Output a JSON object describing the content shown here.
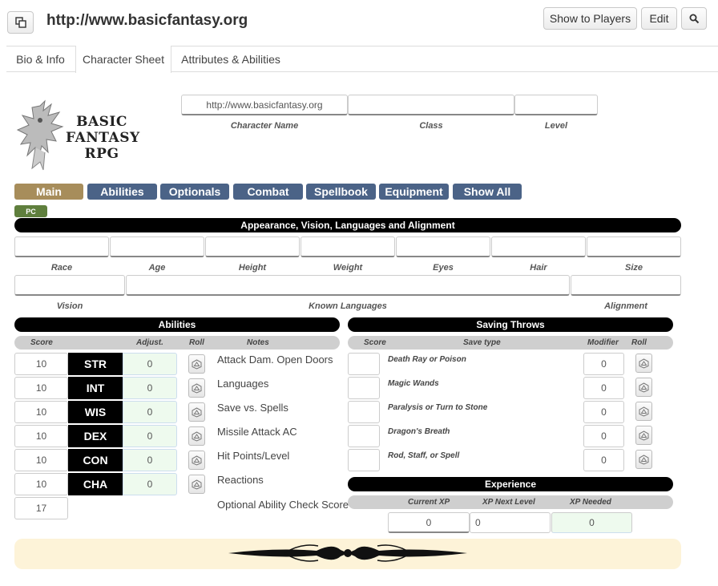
{
  "header": {
    "title": "http://www.basicfantasy.org",
    "show_to_players": "Show to Players",
    "edit": "Edit"
  },
  "tabs": [
    {
      "label": "Bio & Info"
    },
    {
      "label": "Character Sheet"
    },
    {
      "label": "Attributes & Abilities"
    }
  ],
  "logo": {
    "line1": "BASIC",
    "line2": "FANTASY",
    "line3": "RPG"
  },
  "top_fields": {
    "character_name_value": "http://www.basicfantasy.org",
    "character_name_label": "Character Name",
    "class_label": "Class",
    "level_label": "Level"
  },
  "nav": [
    "Main",
    "Abilities",
    "Optionals",
    "Combat",
    "Spellbook",
    "Equipment",
    "Show All"
  ],
  "badge": "PC",
  "appearance": {
    "title": "Appearance, Vision, Languages and Alignment",
    "labels": [
      "Race",
      "Age",
      "Height",
      "Weight",
      "Eyes",
      "Hair",
      "Size"
    ],
    "vision": "Vision",
    "known_languages": "Known Languages",
    "alignment": "Alignment"
  },
  "abilities": {
    "title": "Abilities",
    "headers": {
      "score": "Score",
      "adjust": "Adjust.",
      "roll": "Roll",
      "notes": "Notes"
    },
    "rows": [
      {
        "score": "10",
        "abbr": "STR",
        "adj": "0",
        "note": "Attack Dam. Open Doors"
      },
      {
        "score": "10",
        "abbr": "INT",
        "adj": "0",
        "note": "Languages"
      },
      {
        "score": "10",
        "abbr": "WIS",
        "adj": "0",
        "note": "Save vs. Spells"
      },
      {
        "score": "10",
        "abbr": "DEX",
        "adj": "0",
        "note": "Missile Attack AC"
      },
      {
        "score": "10",
        "abbr": "CON",
        "adj": "0",
        "note": "Hit Points/Level"
      },
      {
        "score": "10",
        "abbr": "CHA",
        "adj": "0",
        "note": "Reactions"
      }
    ],
    "optional_score": "17",
    "optional_note": "Optional Ability Check Score"
  },
  "saving_throws": {
    "title": "Saving Throws",
    "headers": {
      "score": "Score",
      "save_type": "Save type",
      "modifier": "Modifier",
      "roll": "Roll"
    },
    "rows": [
      {
        "type": "Death Ray or Poison",
        "mod": "0"
      },
      {
        "type": "Magic Wands",
        "mod": "0"
      },
      {
        "type": "Paralysis or Turn to Stone",
        "mod": "0"
      },
      {
        "type": "Dragon's Breath",
        "mod": "0"
      },
      {
        "type": "Rod, Staff, or Spell",
        "mod": "0"
      }
    ]
  },
  "experience": {
    "title": "Experience",
    "current_label": "Current XP",
    "next_label": "XP Next Level",
    "needed_label": "XP Needed",
    "current": "0",
    "next": "0",
    "needed": "0"
  },
  "colors": {
    "nav": "#4b6387",
    "nav_active": "#a78d5b",
    "badge": "#5f7f3d",
    "adjust_bg": "#eefaee",
    "footer_bg": "#fdf3d8"
  }
}
